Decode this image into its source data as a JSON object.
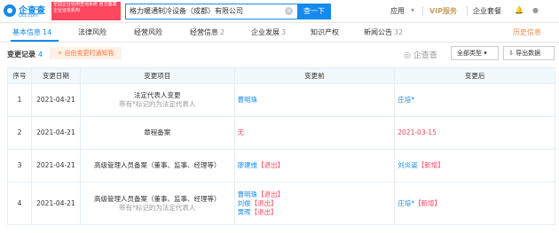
{
  "header": {
    "logo_text": "企查查",
    "logo_sub": "Qcc.com",
    "badge_text": "全国企业信用查询系统 官方备案企业征信机构",
    "search_value": "格力暖通制冷设备（成都）有限公司",
    "search_button": "查一下",
    "nav": [
      "应用",
      "VIP服务",
      "企业套餐"
    ]
  },
  "tabs": [
    {
      "label": "基本信息",
      "count": "14",
      "active": true
    },
    {
      "label": "法律风险",
      "count": ""
    },
    {
      "label": "经营风险",
      "count": ""
    },
    {
      "label": "经营信息",
      "count": "2"
    },
    {
      "label": "企业发展",
      "count": "3"
    },
    {
      "label": "知识产权",
      "count": ""
    },
    {
      "label": "新闻公告",
      "count": "32"
    },
    {
      "label": "历史信息",
      "count": ""
    }
  ],
  "section": {
    "title": "变更记录",
    "count": "4",
    "notify_button": "+ 自由变更时通知我",
    "brand": "企查查",
    "filter_label": "全部类型",
    "export_label": "导出数据"
  },
  "table": {
    "headers": [
      "序号",
      "变更日期",
      "变更项目",
      "变更前",
      "变更后"
    ],
    "rows": [
      {
        "idx": "1",
        "date": "2021-04-21",
        "item": "法定代表人变更",
        "note": "带有*标记的为法定代表人",
        "before": [
          {
            "text": "曹明珠",
            "tag": ""
          }
        ],
        "after": [
          {
            "text": "庄培*",
            "tag": ""
          }
        ]
      },
      {
        "idx": "2",
        "date": "2021-04-21",
        "item": "章程备案",
        "note": "",
        "before": [
          {
            "text": "无",
            "tag": ""
          }
        ],
        "after": [
          {
            "text": "2021-03-15",
            "tag": ""
          }
        ]
      },
      {
        "idx": "3",
        "date": "2021-04-21",
        "item": "高级管理人员备案（董事、监事、经理等）",
        "note": "",
        "before": [
          {
            "text": "廖建维",
            "tag": "【退出】"
          }
        ],
        "after": [
          {
            "text": "刘炎姿",
            "tag": "【新增】"
          }
        ]
      },
      {
        "idx": "4",
        "date": "2021-04-21",
        "item": "高级管理人员备案（董事、监事、经理等）",
        "note": "带有*标记的为法定代表人",
        "before": [
          {
            "text": "曹明珠",
            "tag": "【退出】"
          },
          {
            "text": "刘俊",
            "tag": "【退出】"
          },
          {
            "text": "黄晖",
            "tag": "【退出】"
          }
        ],
        "after": [
          {
            "text": "庄培*",
            "tag": "【新增】"
          }
        ]
      }
    ]
  },
  "colors": {
    "accent": "#128bed",
    "danger": "#fd485e",
    "vip": "#c8a064",
    "history": "#f2894b"
  }
}
